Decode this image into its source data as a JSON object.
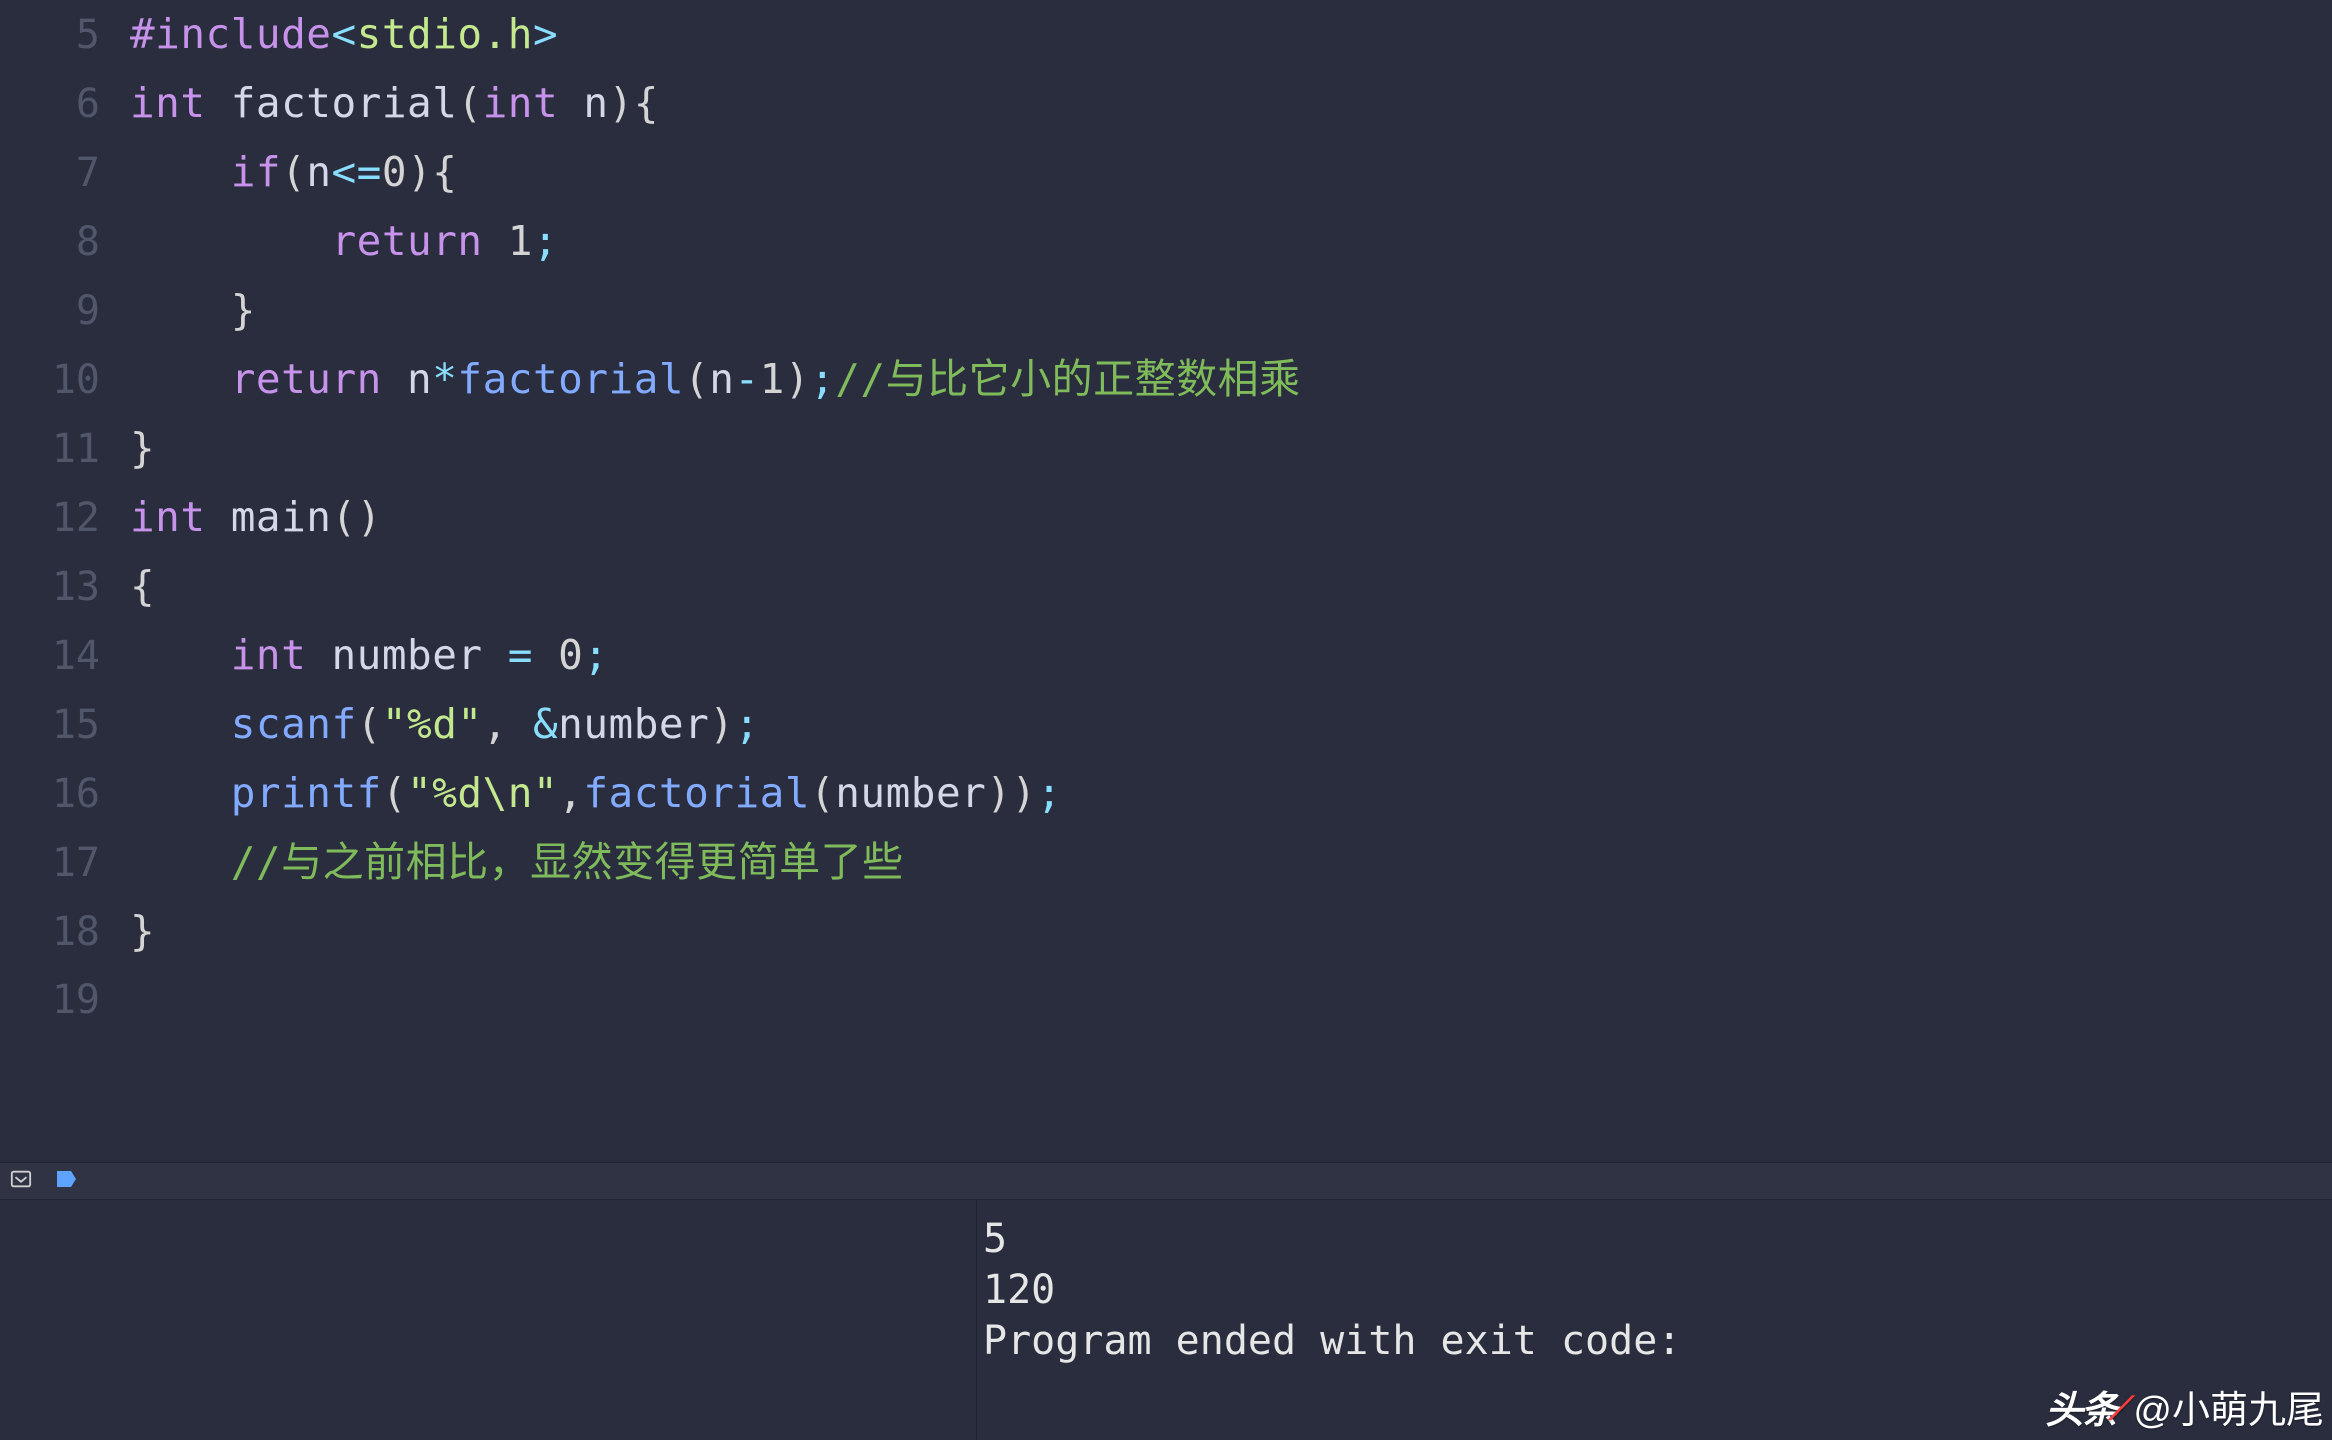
{
  "editor": {
    "lines": [
      {
        "n": "5",
        "tokens": [
          {
            "c": "tk-directive",
            "t": "#include"
          },
          {
            "c": "tk-angle",
            "t": "<"
          },
          {
            "c": "tk-header",
            "t": "stdio.h"
          },
          {
            "c": "tk-angle",
            "t": ">"
          }
        ]
      },
      {
        "n": "6",
        "tokens": [
          {
            "c": "tk-type",
            "t": "int"
          },
          {
            "c": "",
            "t": " "
          },
          {
            "c": "tk-ident",
            "t": "factorial"
          },
          {
            "c": "tk-paren",
            "t": "("
          },
          {
            "c": "tk-type",
            "t": "int"
          },
          {
            "c": "",
            "t": " "
          },
          {
            "c": "tk-ident",
            "t": "n"
          },
          {
            "c": "tk-paren",
            "t": ")"
          },
          {
            "c": "tk-brace",
            "t": "{"
          }
        ]
      },
      {
        "n": "7",
        "tokens": [
          {
            "c": "",
            "t": "    "
          },
          {
            "c": "tk-kw",
            "t": "if"
          },
          {
            "c": "tk-paren",
            "t": "("
          },
          {
            "c": "tk-ident",
            "t": "n"
          },
          {
            "c": "tk-op",
            "t": "<="
          },
          {
            "c": "tk-num",
            "t": "0"
          },
          {
            "c": "tk-paren",
            "t": ")"
          },
          {
            "c": "tk-brace",
            "t": "{"
          }
        ]
      },
      {
        "n": "8",
        "tokens": [
          {
            "c": "",
            "t": "        "
          },
          {
            "c": "tk-kw",
            "t": "return"
          },
          {
            "c": "",
            "t": " "
          },
          {
            "c": "tk-num",
            "t": "1"
          },
          {
            "c": "tk-semi",
            "t": ";"
          }
        ]
      },
      {
        "n": "9",
        "tokens": [
          {
            "c": "",
            "t": "    "
          },
          {
            "c": "tk-brace",
            "t": "}"
          }
        ]
      },
      {
        "n": "10",
        "tokens": [
          {
            "c": "",
            "t": "    "
          },
          {
            "c": "tk-kw",
            "t": "return"
          },
          {
            "c": "",
            "t": " "
          },
          {
            "c": "tk-ident",
            "t": "n"
          },
          {
            "c": "tk-op",
            "t": "*"
          },
          {
            "c": "tk-func",
            "t": "factorial"
          },
          {
            "c": "tk-paren",
            "t": "("
          },
          {
            "c": "tk-ident",
            "t": "n"
          },
          {
            "c": "tk-op",
            "t": "-"
          },
          {
            "c": "tk-num",
            "t": "1"
          },
          {
            "c": "tk-paren",
            "t": ")"
          },
          {
            "c": "tk-semi",
            "t": ";"
          },
          {
            "c": "tk-comment",
            "t": "//与比它小的正整数相乘"
          }
        ]
      },
      {
        "n": "11",
        "tokens": [
          {
            "c": "tk-brace",
            "t": "}"
          }
        ]
      },
      {
        "n": "12",
        "tokens": [
          {
            "c": "tk-type",
            "t": "int"
          },
          {
            "c": "",
            "t": " "
          },
          {
            "c": "tk-ident",
            "t": "main"
          },
          {
            "c": "tk-paren",
            "t": "()"
          }
        ]
      },
      {
        "n": "13",
        "tokens": [
          {
            "c": "tk-brace",
            "t": "{"
          }
        ]
      },
      {
        "n": "14",
        "tokens": [
          {
            "c": "",
            "t": "    "
          },
          {
            "c": "tk-type",
            "t": "int"
          },
          {
            "c": "",
            "t": " "
          },
          {
            "c": "tk-ident",
            "t": "number"
          },
          {
            "c": "",
            "t": " "
          },
          {
            "c": "tk-op",
            "t": "="
          },
          {
            "c": "",
            "t": " "
          },
          {
            "c": "tk-num",
            "t": "0"
          },
          {
            "c": "tk-semi",
            "t": ";"
          }
        ]
      },
      {
        "n": "15",
        "tokens": [
          {
            "c": "",
            "t": "    "
          },
          {
            "c": "tk-func",
            "t": "scanf"
          },
          {
            "c": "tk-paren",
            "t": "("
          },
          {
            "c": "tk-str",
            "t": "\"%d\""
          },
          {
            "c": "tk-paren",
            "t": ","
          },
          {
            "c": "",
            "t": " "
          },
          {
            "c": "tk-amp",
            "t": "&"
          },
          {
            "c": "tk-ident",
            "t": "number"
          },
          {
            "c": "tk-paren",
            "t": ")"
          },
          {
            "c": "tk-semi",
            "t": ";"
          }
        ]
      },
      {
        "n": "16",
        "tokens": [
          {
            "c": "",
            "t": "    "
          },
          {
            "c": "tk-func",
            "t": "printf"
          },
          {
            "c": "tk-paren",
            "t": "("
          },
          {
            "c": "tk-str",
            "t": "\"%d\\n\""
          },
          {
            "c": "tk-paren",
            "t": ","
          },
          {
            "c": "tk-func",
            "t": "factorial"
          },
          {
            "c": "tk-paren",
            "t": "("
          },
          {
            "c": "tk-ident",
            "t": "number"
          },
          {
            "c": "tk-paren",
            "t": ")"
          },
          {
            "c": "tk-paren",
            "t": ")"
          },
          {
            "c": "tk-semi",
            "t": ";"
          }
        ]
      },
      {
        "n": "17",
        "tokens": [
          {
            "c": "",
            "t": "    "
          },
          {
            "c": "tk-comment",
            "t": "//与之前相比，显然变得更简单了些"
          }
        ]
      },
      {
        "n": "18",
        "tokens": [
          {
            "c": "tk-brace",
            "t": "}"
          }
        ]
      },
      {
        "n": "19",
        "tokens": [
          {
            "c": "",
            "t": ""
          }
        ]
      }
    ]
  },
  "console": {
    "lines": [
      "5",
      "120",
      "Program ended with exit code:"
    ]
  },
  "watermark": {
    "logo": "头条",
    "handle": "@小萌九尾"
  }
}
